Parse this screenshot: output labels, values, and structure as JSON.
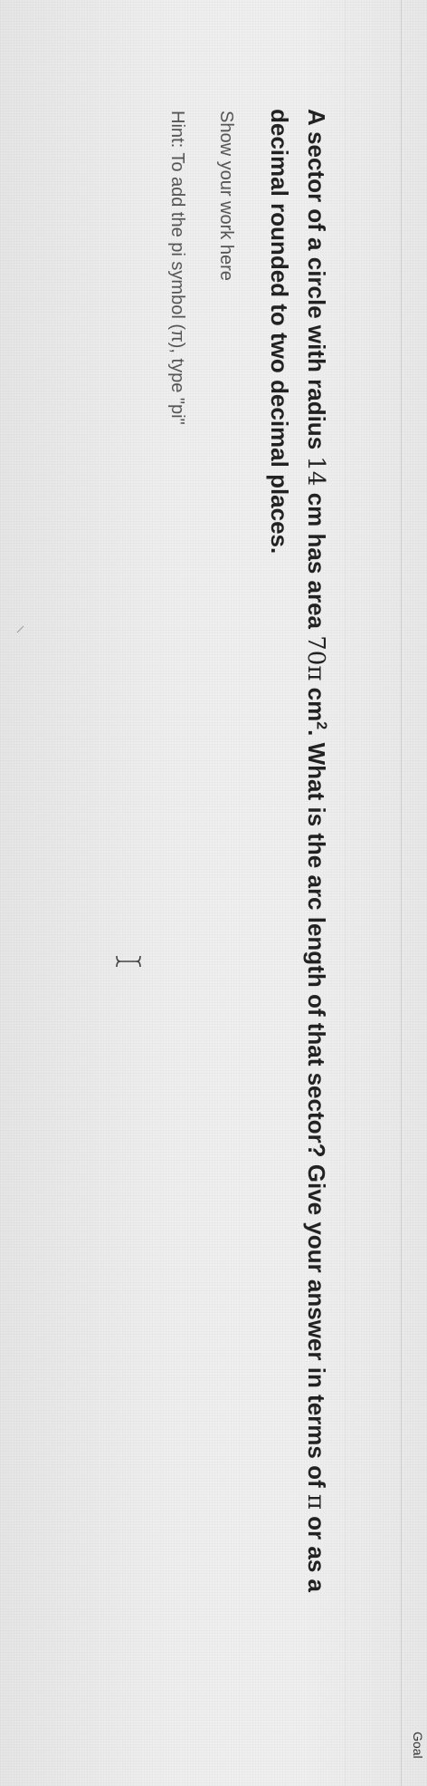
{
  "header": {
    "goal_label": "Goal"
  },
  "question": {
    "part1": "A sector of a circle with radius ",
    "radius": "14",
    "part2": " cm has area ",
    "area": "70π",
    "part3": " cm",
    "exponent": "2",
    "part4": ". What is the arc length of that sector? Give your answer in terms of ",
    "pi": "π",
    "part5": " or as a decimal rounded to two decimal places."
  },
  "answer_box": {
    "placeholder": "Show your work here",
    "hint": "Hint: To add the pi symbol (π), type \"pi\""
  },
  "icons": {
    "text_cursor": "text-cursor-icon",
    "keypad": "keypad-icon"
  }
}
